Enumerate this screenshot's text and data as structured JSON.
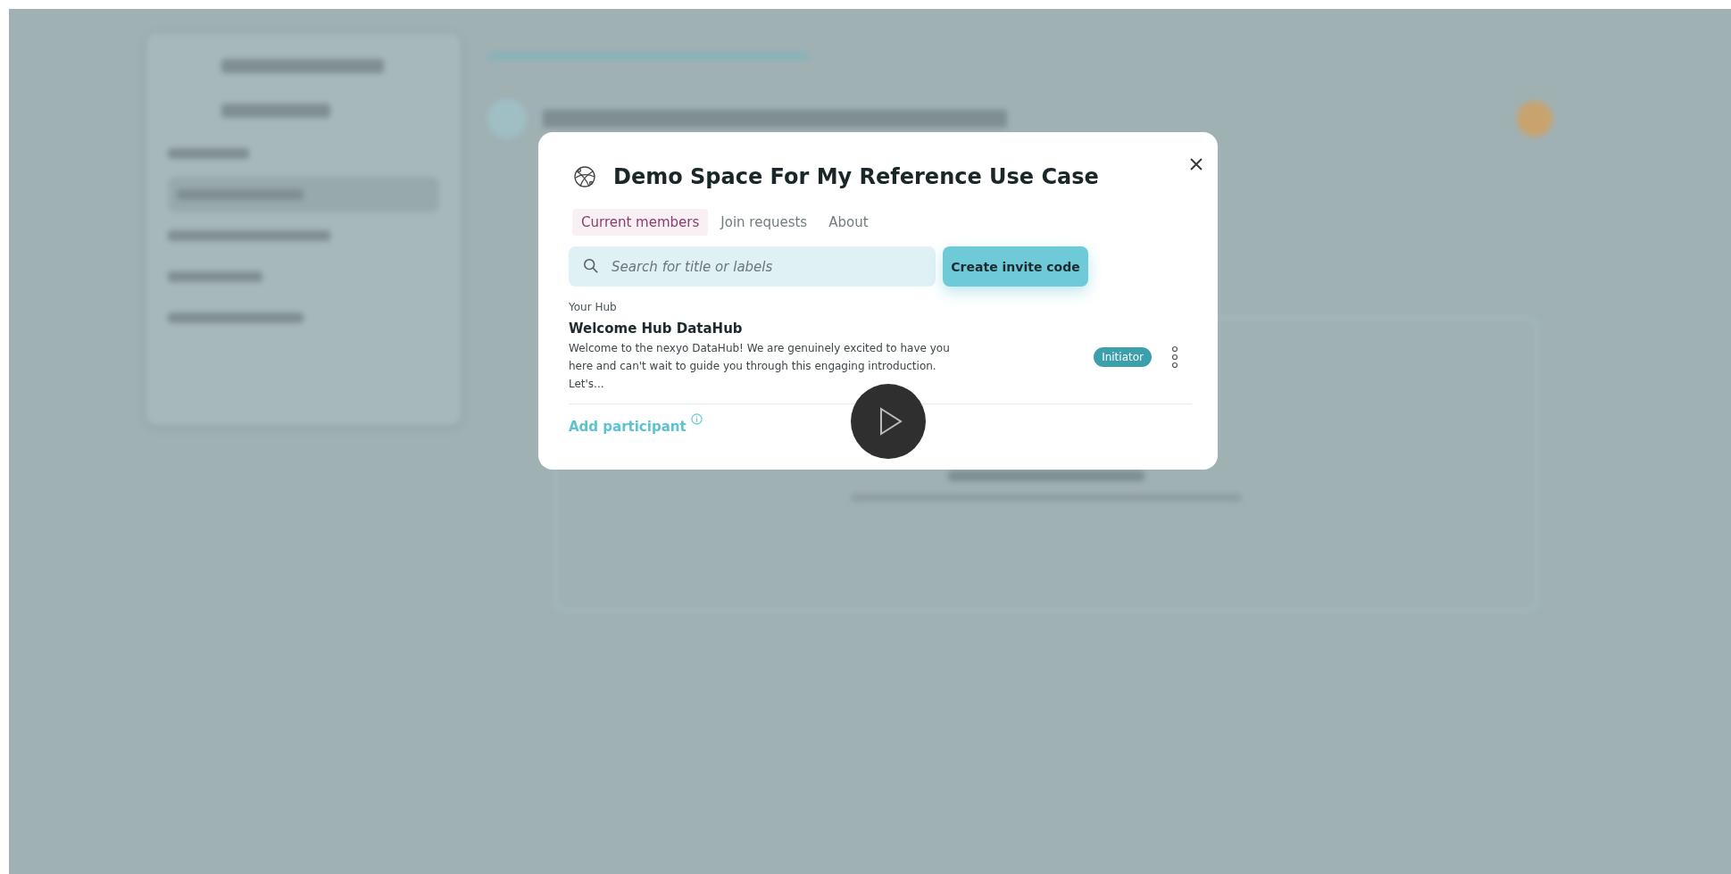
{
  "dialog": {
    "title": "Demo Space For My Reference Use Case",
    "tabs": [
      {
        "label": "Current members",
        "selected": true
      },
      {
        "label": "Join requests",
        "selected": false
      },
      {
        "label": "About",
        "selected": false
      }
    ],
    "search": {
      "placeholder": "Search for title or labels"
    },
    "invite_button": {
      "label": "Create invite code"
    },
    "section_label": "Your Hub",
    "members": [
      {
        "name": "Welcome Hub DataHub",
        "description": "Welcome to the nexyo DataHub! We are genuinely excited to have you here and can't wait to guide you through this engaging introduction. Let's...",
        "role": "Initiator"
      }
    ],
    "add_participant": {
      "label": "Add participant"
    }
  }
}
